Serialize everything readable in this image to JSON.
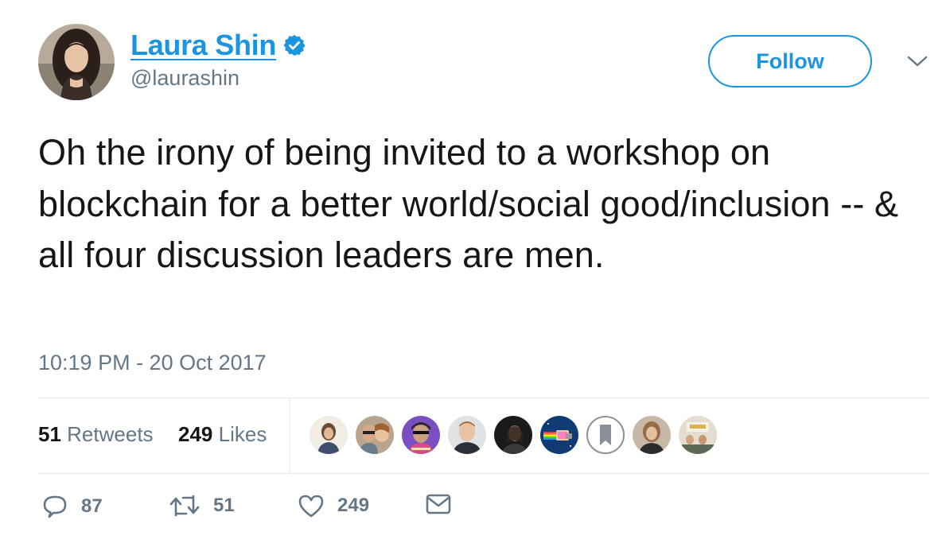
{
  "author": {
    "display_name": "Laura Shin",
    "handle": "@laurashin",
    "verified": true,
    "avatar_icon": "profile-photo"
  },
  "follow_button": {
    "label": "Follow"
  },
  "menu_icon": "chevron-down-icon",
  "tweet": {
    "text": "Oh the irony of being invited to a workshop on blockchain for a better world/social good/inclusion -- & all four discussion leaders are men.",
    "timestamp": "10:19 PM - 20 Oct 2017"
  },
  "stats": {
    "retweets_count": "51",
    "retweets_label": "Retweets",
    "likes_count": "249",
    "likes_label": "Likes"
  },
  "likers": [
    {
      "icon": "liker-avatar"
    },
    {
      "icon": "liker-avatar"
    },
    {
      "icon": "liker-avatar"
    },
    {
      "icon": "liker-avatar"
    },
    {
      "icon": "liker-avatar"
    },
    {
      "icon": "liker-avatar-nyan-cat"
    },
    {
      "icon": "liker-avatar-bookmark"
    },
    {
      "icon": "liker-avatar"
    },
    {
      "icon": "liker-avatar"
    }
  ],
  "actions": {
    "reply_count": "87",
    "retweet_count": "51",
    "like_count": "249"
  },
  "colors": {
    "accent": "#1b95e0",
    "text": "#14171a",
    "secondary": "#657786",
    "divider": "#e6ecf0"
  }
}
